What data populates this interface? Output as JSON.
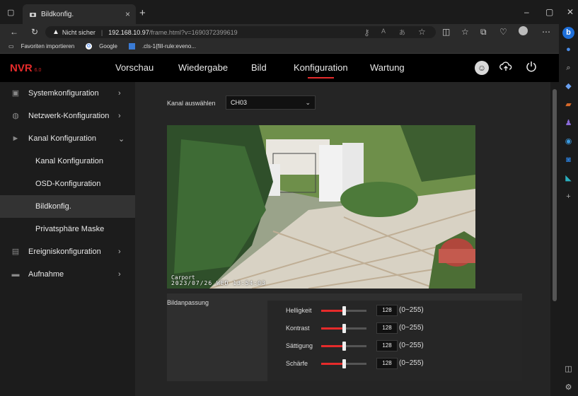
{
  "browser": {
    "tab_title": "Bildkonfig.",
    "tab_close": "×",
    "new_tab": "+",
    "security_label": "Nicht sicher",
    "url_host": "192.168.10.97",
    "url_path": "/frame.html?v=1690372399619",
    "favorites": [
      {
        "label": "Favoriten importieren",
        "icon": "import-icon"
      },
      {
        "label": "Google",
        "icon": "google-icon"
      },
      {
        "label": ".cls-1{fill-rule:eveno...",
        "icon": "file-icon"
      }
    ]
  },
  "nvr": {
    "logo": "NVR",
    "logo_version": "6.0",
    "nav": [
      {
        "label": "Vorschau",
        "active": false
      },
      {
        "label": "Wiedergabe",
        "active": false
      },
      {
        "label": "Bild",
        "active": false
      },
      {
        "label": "Konfiguration",
        "active": true
      },
      {
        "label": "Wartung",
        "active": false
      }
    ],
    "accent_color": "#e52b2b"
  },
  "sidebar": {
    "items": [
      {
        "label": "Systemkonfiguration",
        "icon": "monitor-icon",
        "chevron": "›"
      },
      {
        "label": "Netzwerk-Konfiguration",
        "icon": "globe-icon",
        "chevron": "›"
      },
      {
        "label": "Kanal Konfiguration",
        "icon": "camera-icon",
        "chevron": "⌄"
      },
      {
        "label": "Kanal Konfiguration"
      },
      {
        "label": "OSD-Konfiguration"
      },
      {
        "label": "Bildkonfig.",
        "selected": true
      },
      {
        "label": "Privatsphäre Maske"
      },
      {
        "label": "Ereigniskonfiguration",
        "icon": "calendar-icon",
        "chevron": "›"
      },
      {
        "label": "Aufnahme",
        "icon": "record-icon",
        "chevron": "›"
      }
    ]
  },
  "main": {
    "channel_label": "Kanal auswählen",
    "channel_value": "CH03",
    "osd_name": "Carport",
    "osd_datetime": "2023/07/26 WED 13:54:03",
    "adjust_title": "Bildanpassung",
    "sliders": [
      {
        "label": "Helligkeit",
        "value": "128",
        "range": "(0~255)",
        "fraction": 0.5
      },
      {
        "label": "Kontrast",
        "value": "128",
        "range": "(0~255)",
        "fraction": 0.5
      },
      {
        "label": "Sättigung",
        "value": "128",
        "range": "(0~255)",
        "fraction": 0.5
      },
      {
        "label": "Schärfe",
        "value": "128",
        "range": "(0~255)",
        "fraction": 0.5
      }
    ]
  }
}
